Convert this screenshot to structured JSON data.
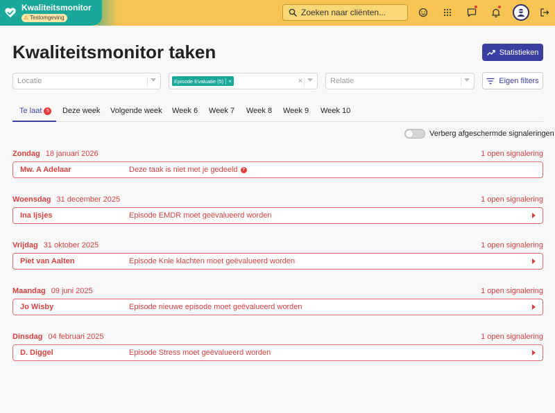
{
  "app": {
    "title": "Kwaliteitsmonitor",
    "environment": "Testomgeving"
  },
  "search": {
    "placeholder": "Zoeken naar cliënten..."
  },
  "toolbar": {
    "icons": [
      "search-icon",
      "mood-icon",
      "apps-grid-icon",
      "messages-icon",
      "notifications-icon",
      "avatar",
      "logout-icon"
    ],
    "colors": {
      "brand": "#1aa89b",
      "bar": "#f6c453",
      "accent": "#3b3ea3",
      "alert": "#d84040"
    }
  },
  "header": {
    "title": "Kwaliteitsmonitor taken",
    "stats_label": "Statistieken"
  },
  "filters": {
    "location_placeholder": "Locatie",
    "episode_chip": "Episode Evaluatie (5)",
    "relation_placeholder": "Relatie",
    "own_filters_label": "Eigen filters"
  },
  "tabs": [
    {
      "label": "Te laat",
      "badge": "5"
    },
    {
      "label": "Deze week"
    },
    {
      "label": "Volgende week"
    },
    {
      "label": "Week 6"
    },
    {
      "label": "Week 7"
    },
    {
      "label": "Week 8"
    },
    {
      "label": "Week 9"
    },
    {
      "label": "Week 10"
    }
  ],
  "toggle": {
    "label": "Verberg afgeschermde signaleringen"
  },
  "groups": [
    {
      "day": "Zondag",
      "date": "18 januari 2026",
      "count": "1 open signalering",
      "client": "Mw. A Adelaar",
      "message": "Deze taak is niet met je gedeeld"
    },
    {
      "day": "Woensdag",
      "date": "31 december 2025",
      "count": "1 open signalering",
      "client": "Ina Ijsjes",
      "message": "Episode EMDR moet geëvalueerd worden"
    },
    {
      "day": "Vrijdag",
      "date": "31 oktober 2025",
      "count": "1 open signalering",
      "client": "Piet van Aalten",
      "message": "Episode Knie klachten moet geëvalueerd worden"
    },
    {
      "day": "Maandag",
      "date": "09 juni 2025",
      "count": "1 open signalering",
      "client": "Jo Wisby",
      "message": "Episode nieuwe episode moet geëvalueerd worden"
    },
    {
      "day": "Dinsdag",
      "date": "04 februari 2025",
      "count": "1 open signalering",
      "client": "D. Diggel",
      "message": "Episode Stress moet geëvalueerd worden"
    }
  ]
}
